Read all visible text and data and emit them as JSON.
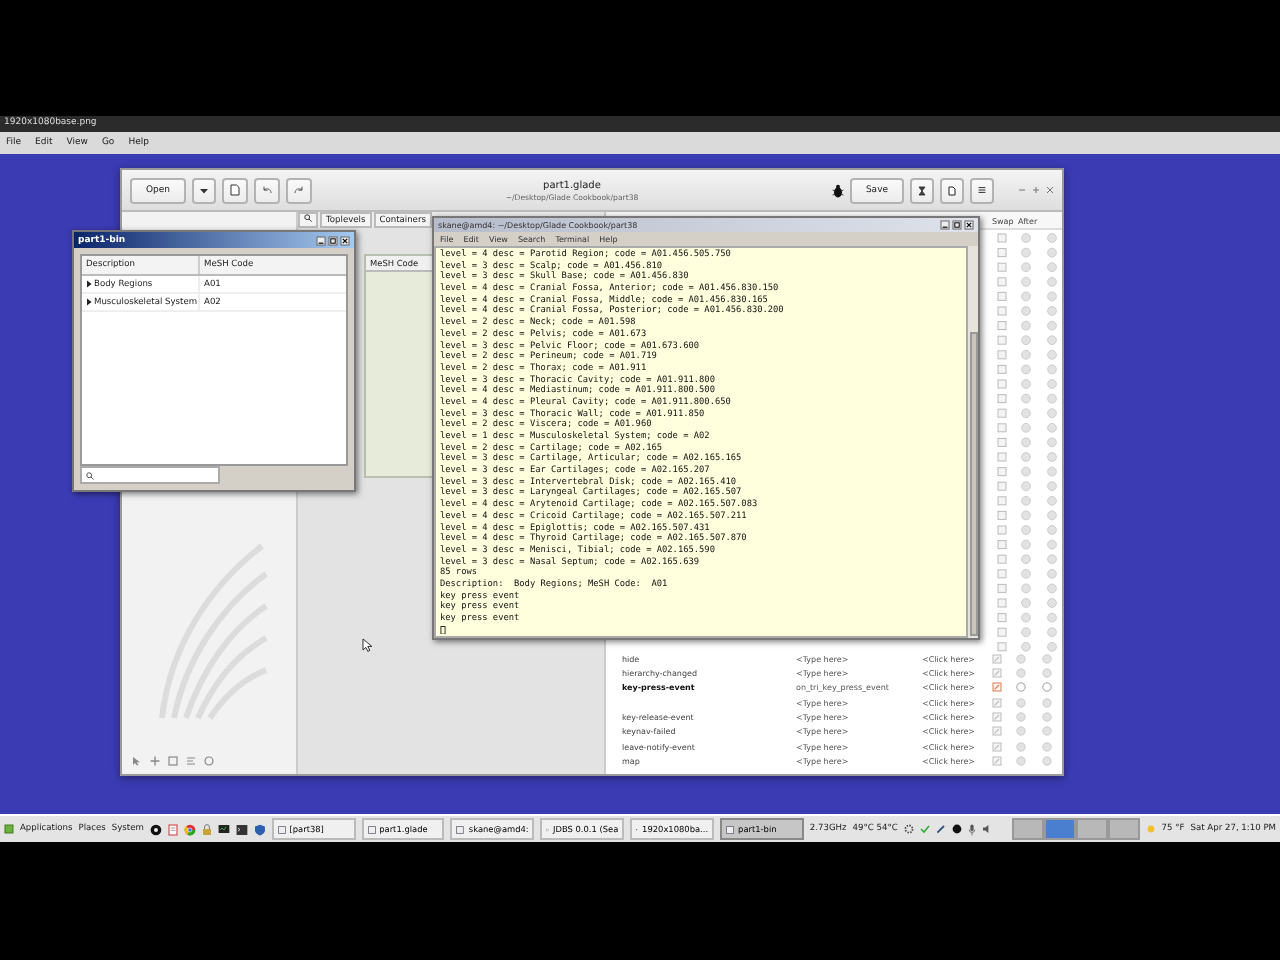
{
  "viewer": {
    "title": "1920x1080base.png",
    "menu": [
      "File",
      "Edit",
      "View",
      "Go",
      "Help"
    ]
  },
  "glade": {
    "open_button": "Open",
    "title": "part1.glade",
    "subtitle": "~/Desktop/Glade Cookbook/part38",
    "save_button": "Save",
    "tabs": [
      "Toplevels",
      "Containers"
    ],
    "preview_column": "MeSH Code",
    "signal_columns": [
      "Swap",
      "After"
    ],
    "signals": [
      {
        "name": "hide",
        "handler": "<Type here>",
        "user_data": "<Click here>",
        "connected": false
      },
      {
        "name": "hierarchy-changed",
        "handler": "<Type here>",
        "user_data": "<Click here>",
        "connected": false
      },
      {
        "name": "key-press-event",
        "handler": "on_tri_key_press_event",
        "user_data": "<Click here>",
        "connected": true
      },
      {
        "handler": "<Type here>",
        "user_data": "<Click here>",
        "connected": false
      },
      {
        "name": "key-release-event",
        "handler": "<Type here>",
        "user_data": "<Click here>",
        "connected": false
      },
      {
        "name": "keynav-failed",
        "handler": "<Type here>",
        "user_data": "<Click here>",
        "connected": false
      },
      {
        "name": "leave-notify-event",
        "handler": "<Type here>",
        "user_data": "<Click here>",
        "connected": false
      },
      {
        "name": "map",
        "handler": "<Type here>",
        "user_data": "<Click here>",
        "connected": false
      }
    ]
  },
  "bin_window": {
    "title": "part1-bin",
    "columns": [
      "Description",
      "MeSH Code"
    ],
    "rows": [
      {
        "description": "Body Regions",
        "code": "A01",
        "expanded": false
      },
      {
        "description": "Musculoskeletal System",
        "code": "A02",
        "expanded": false
      }
    ]
  },
  "terminal": {
    "title": "skane@amd4: ~/Desktop/Glade Cookbook/part38",
    "menu": [
      "File",
      "Edit",
      "View",
      "Search",
      "Terminal",
      "Help"
    ],
    "lines": [
      "level = 4 desc = Parotid Region; code = A01.456.505.750",
      "level = 3 desc = Scalp; code = A01.456.810",
      "level = 3 desc = Skull Base; code = A01.456.830",
      "level = 4 desc = Cranial Fossa, Anterior; code = A01.456.830.150",
      "level = 4 desc = Cranial Fossa, Middle; code = A01.456.830.165",
      "level = 4 desc = Cranial Fossa, Posterior; code = A01.456.830.200",
      "level = 2 desc = Neck; code = A01.598",
      "level = 2 desc = Pelvis; code = A01.673",
      "level = 3 desc = Pelvic Floor; code = A01.673.600",
      "level = 2 desc = Perineum; code = A01.719",
      "level = 2 desc = Thorax; code = A01.911",
      "level = 3 desc = Thoracic Cavity; code = A01.911.800",
      "level = 4 desc = Mediastinum; code = A01.911.800.500",
      "level = 4 desc = Pleural Cavity; code = A01.911.800.650",
      "level = 3 desc = Thoracic Wall; code = A01.911.850",
      "level = 2 desc = Viscera; code = A01.960",
      "level = 1 desc = Musculoskeletal System; code = A02",
      "level = 2 desc = Cartilage; code = A02.165",
      "level = 3 desc = Cartilage, Articular; code = A02.165.165",
      "level = 3 desc = Ear Cartilages; code = A02.165.207",
      "level = 3 desc = Intervertebral Disk; code = A02.165.410",
      "level = 3 desc = Laryngeal Cartilages; code = A02.165.507",
      "level = 4 desc = Arytenoid Cartilage; code = A02.165.507.083",
      "level = 4 desc = Cricoid Cartilage; code = A02.165.507.211",
      "level = 4 desc = Epiglottis; code = A02.165.507.431",
      "level = 4 desc = Thyroid Cartilage; code = A02.165.507.870",
      "level = 3 desc = Menisci, Tibial; code = A02.165.590",
      "level = 3 desc = Nasal Septum; code = A02.165.639",
      "85 rows",
      "Description:  Body Regions; MeSH Code:  A01",
      "key press event",
      "key press event",
      "key press event"
    ]
  },
  "taskbar": {
    "menu": [
      "Applications",
      "Places",
      "System"
    ],
    "tasks": [
      {
        "label": "[part38]",
        "selected": false
      },
      {
        "label": "part1.glade",
        "selected": false
      },
      {
        "label": "skane@amd4:",
        "selected": false
      },
      {
        "label": "JDBS 0.0.1 (Sea",
        "selected": false
      },
      {
        "label": "1920x1080ba...",
        "selected": false
      },
      {
        "label": "part1-bin",
        "selected": true
      }
    ],
    "cpu": "2.73GHz",
    "temperature": "49°C 54°C",
    "workspaces": [
      {
        "selected": false
      },
      {
        "selected": true
      },
      {
        "selected": false
      },
      {
        "selected": false
      }
    ],
    "weather": "75 °F",
    "clock": "Sat Apr 27, 1:10 PM"
  }
}
